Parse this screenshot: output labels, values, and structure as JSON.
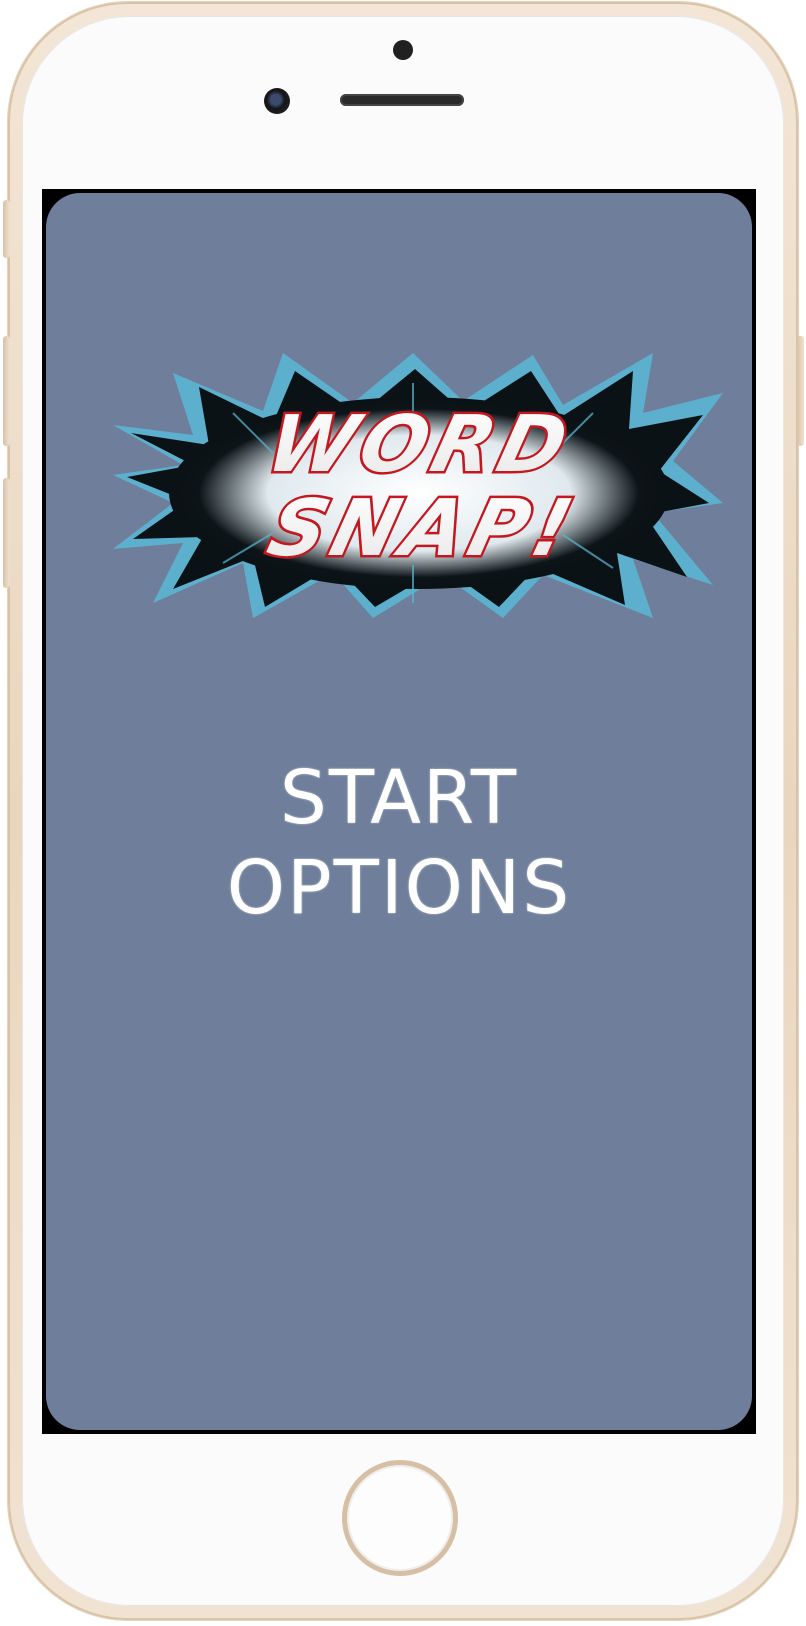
{
  "app": {
    "logo": {
      "line1": "WORD",
      "line2": "SNAP!"
    },
    "menu": {
      "start_label": "START",
      "options_label": "OPTIONS"
    }
  },
  "colors": {
    "screen_background": "#6e7e9b",
    "menu_text": "#ffffff",
    "logo_text_fill": "#ffffff",
    "logo_text_outline": "#c41820",
    "logo_burst_edge": "#5bb8d6",
    "phone_frame": "#e9d6c0"
  },
  "icons": {
    "front_camera": "front-camera-icon",
    "earpiece": "earpiece-icon",
    "home_button": "home-button-icon"
  }
}
